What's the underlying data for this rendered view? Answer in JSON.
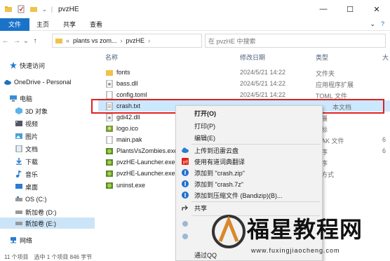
{
  "window": {
    "title": "pvzHE",
    "controls": {
      "minimize": "—",
      "maximize": "☐",
      "close": "✕"
    }
  },
  "ribbon": {
    "tabs": [
      "文件",
      "主页",
      "共享",
      "查看"
    ],
    "right_expand": "⌄",
    "help": "?"
  },
  "address": {
    "path": [
      "plants vs zom...",
      "pvzHE"
    ],
    "back": "←",
    "forward": "→",
    "recent": "⌄",
    "up": "↑",
    "search_placeholder": "在 pvzHE 中搜索"
  },
  "nav": {
    "items": [
      {
        "label": "快速访问",
        "icon": "star-icon",
        "color": "#2b7cd3"
      },
      {
        "label": "OneDrive - Personal",
        "icon": "cloud-icon",
        "color": "#1e73be"
      },
      {
        "label": "电脑",
        "icon": "computer-icon",
        "color": "#3a8ed6"
      },
      {
        "label": "3D 对象",
        "icon": "cube-icon",
        "color": "#5fb2e8"
      },
      {
        "label": "视频",
        "icon": "video-icon",
        "color": "#556"
      },
      {
        "label": "图片",
        "icon": "picture-icon",
        "color": "#4aa0d8"
      },
      {
        "label": "文档",
        "icon": "document-icon",
        "color": "#6a7a8a"
      },
      {
        "label": "下载",
        "icon": "download-icon",
        "color": "#2b7cd3"
      },
      {
        "label": "音乐",
        "icon": "music-icon",
        "color": "#2b7cd3"
      },
      {
        "label": "桌面",
        "icon": "desktop-icon",
        "color": "#2b7cd3"
      },
      {
        "label": "OS (C:)",
        "icon": "drive-icon",
        "color": "#777"
      },
      {
        "label": "新加卷 (D:)",
        "icon": "drive-icon",
        "color": "#777"
      },
      {
        "label": "新加卷 (E:)",
        "icon": "drive-icon",
        "color": "#777"
      },
      {
        "label": "网络",
        "icon": "network-icon",
        "color": "#2b7cd3"
      }
    ]
  },
  "columns": {
    "name": "名称",
    "modified": "修改日期",
    "type": "类型",
    "size": "大"
  },
  "files": [
    {
      "name": "fonts",
      "date": "2024/5/21 14:22",
      "type": "文件夹",
      "size": "",
      "icon": "folder-icon"
    },
    {
      "name": "bass.dll",
      "date": "2024/5/21 14:22",
      "type": "应用程序扩展",
      "size": "",
      "icon": "dll-icon"
    },
    {
      "name": "config.toml",
      "date": "2024/5/21 14:22",
      "type": "TOML 文件",
      "size": "",
      "icon": "file-icon"
    },
    {
      "name": "crash.txt",
      "date": "",
      "type": "本文档",
      "size": "",
      "icon": "text-file-icon"
    },
    {
      "name": "gdi42.dll",
      "date": "",
      "type": "展",
      "size": "",
      "icon": "dll-icon"
    },
    {
      "name": "logo.ico",
      "date": "",
      "type": "标",
      "size": "",
      "icon": "image-icon"
    },
    {
      "name": "main.pak",
      "date": "",
      "type": "AK 文件",
      "size": "6",
      "icon": "file-icon"
    },
    {
      "name": "PlantsVsZombies.exe",
      "date": "",
      "type": "序",
      "size": "6",
      "icon": "exe-icon"
    },
    {
      "name": "pvzHE-Launcher.exe",
      "date": "",
      "type": "序",
      "size": "",
      "icon": "exe-icon"
    },
    {
      "name": "pvzHE-Launcher.exe",
      "date": "",
      "type": "方式",
      "size": "",
      "icon": "exe-icon"
    },
    {
      "name": "uninst.exe",
      "date": "",
      "type": "序",
      "size": "",
      "icon": "exe-icon"
    }
  ],
  "context_menu": {
    "items": [
      {
        "label": "打开(O)",
        "icon": "",
        "bold": true
      },
      {
        "label": "打印(P)",
        "icon": ""
      },
      {
        "label": "编辑(E)",
        "icon": ""
      },
      {
        "label": "上传到迅雷云盘",
        "icon": "thunder-cloud-icon"
      },
      {
        "label": "使用有道词典翻译",
        "icon": "youdao-icon"
      },
      {
        "label": "添加到 \"crash.zip\"",
        "icon": "bandizip-icon"
      },
      {
        "label": "添加到 \"crash.7z\"",
        "icon": "bandizip-icon"
      },
      {
        "label": "添加到压缩文件 (Bandizip)(B)...",
        "icon": "bandizip-icon"
      },
      {
        "label": "共享",
        "icon": "share-icon"
      },
      {
        "label": "",
        "icon": ""
      },
      {
        "label": "",
        "icon": ""
      },
      {
        "label": "",
        "icon": ""
      },
      {
        "label": "通过QQ",
        "icon": ""
      }
    ]
  },
  "status": {
    "count": "11 个项目",
    "selected": "选中 1 个项目  846 字节"
  },
  "watermark": {
    "text": "福星教程网",
    "url": "www.fuxingjiaocheng.com"
  },
  "colors": {
    "accent": "#1a73c9",
    "selection": "#cce8ff",
    "highlight_box": "#e02020"
  }
}
